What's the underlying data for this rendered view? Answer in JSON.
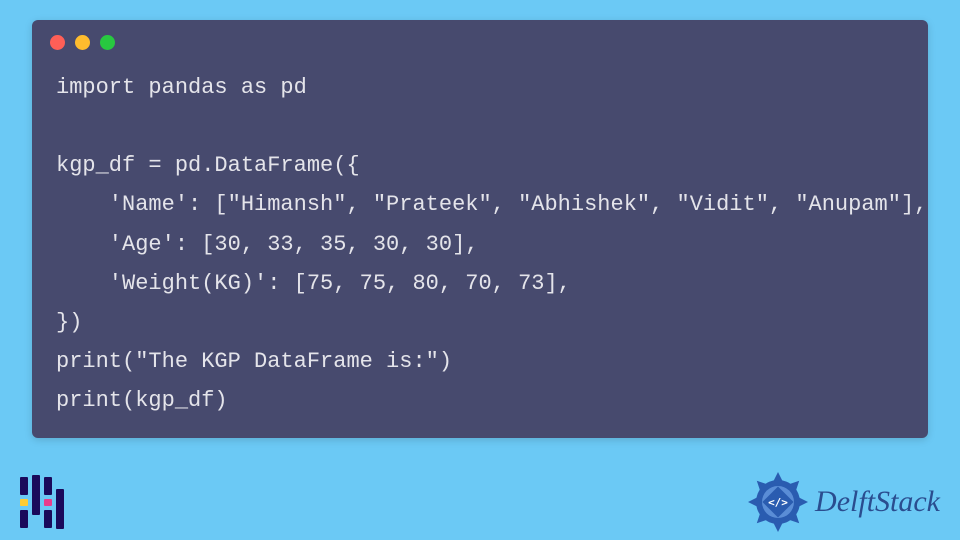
{
  "code": {
    "lines": [
      "import pandas as pd",
      "",
      "kgp_df = pd.DataFrame({",
      "    'Name': [\"Himansh\", \"Prateek\", \"Abhishek\", \"Vidit\", \"Anupam\"],",
      "    'Age': [30, 33, 35, 30, 30],",
      "    'Weight(KG)': [75, 75, 80, 70, 73],",
      "})",
      "print(\"The KGP DataFrame is:\")",
      "print(kgp_df)"
    ]
  },
  "brand": {
    "name": "DelftStack"
  },
  "window": {
    "dot_colors": {
      "red": "#fe5f57",
      "yellow": "#febc2e",
      "green": "#28c840"
    }
  }
}
